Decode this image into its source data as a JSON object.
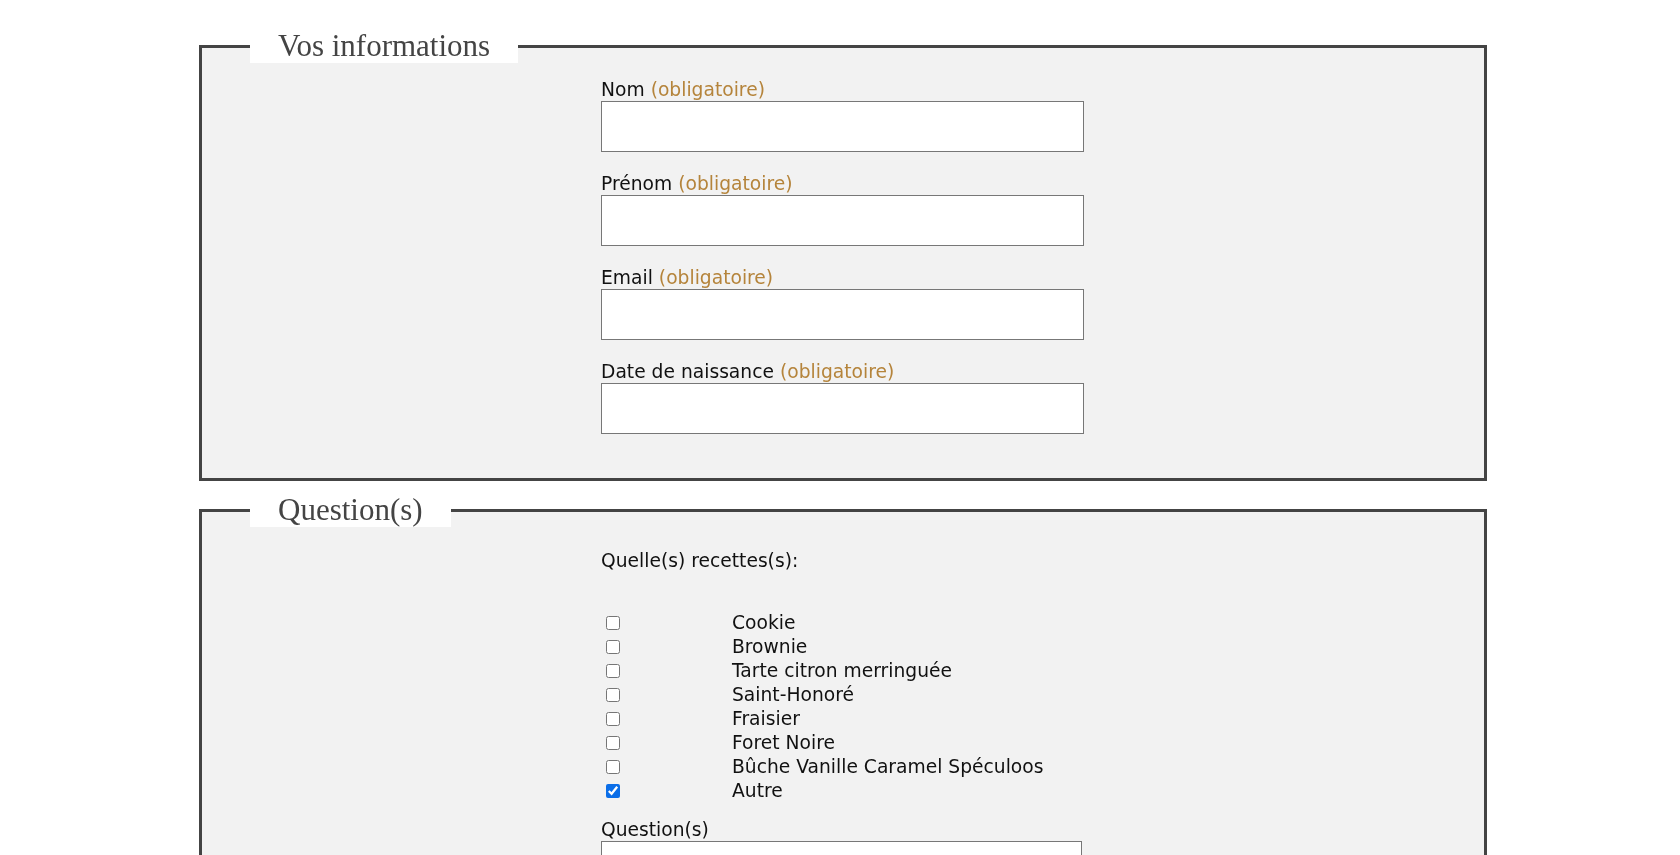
{
  "sections": [
    {
      "title": "Vos informations",
      "fields": [
        {
          "label": "Nom",
          "hint": "(obligatoire)"
        },
        {
          "label": "Prénom",
          "hint": "(obligatoire)"
        },
        {
          "label": "Email",
          "hint": "(obligatoire)"
        },
        {
          "label": "Date de naissance",
          "hint": "(obligatoire)"
        }
      ]
    },
    {
      "title": "Question(s)",
      "prompt": "Quelle(s) recettes(s):",
      "options": [
        {
          "label": "Cookie",
          "checked": false
        },
        {
          "label": "Brownie",
          "checked": false
        },
        {
          "label": "Tarte citron merringuée",
          "checked": false
        },
        {
          "label": "Saint-Honoré",
          "checked": false
        },
        {
          "label": "Fraisier",
          "checked": false
        },
        {
          "label": "Foret Noire",
          "checked": false
        },
        {
          "label": "Bûche Vanille Caramel Spéculoos",
          "checked": false
        },
        {
          "label": "Autre",
          "checked": true
        }
      ],
      "question_label": "Question(s)"
    }
  ]
}
